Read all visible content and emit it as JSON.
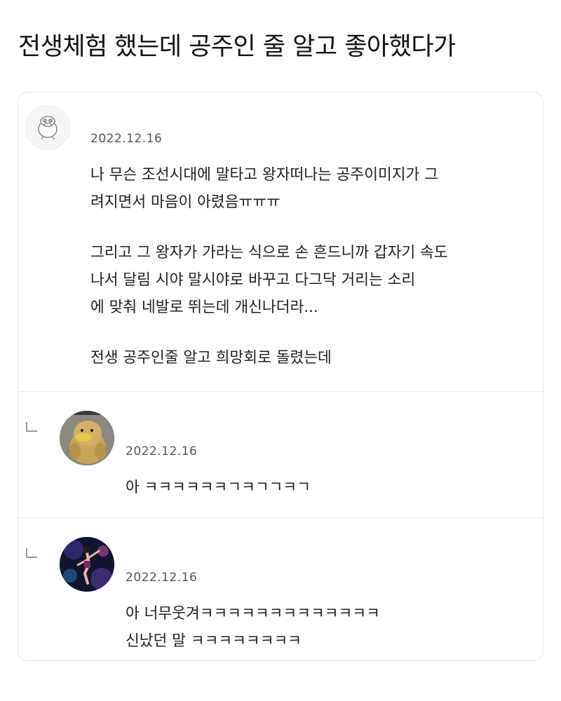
{
  "post_title": "전생체험 했는데 공주인 줄 알고 좋아했다가",
  "comment": {
    "avatar_icon": "character-face-icon",
    "date": "2022.12.16",
    "lines": [
      "나 무슨 조선시대에 말타고 왕자떠나는 공주이미지가 그",
      "려지면서 마음이 아렸음ㅠㅠㅠ",
      "그리고 그 왕자가 가라는 식으로 손 흔드니까 갑자기 속도",
      "나서 달림 시야 말시야로 바꾸고 다그닥 거리는 소리",
      "에 맞춰 네발로 뛰는데 개신나더라...",
      "전생 공주인줄 알고 희망회로 돌렸는데"
    ]
  },
  "replies": [
    {
      "avatar_icon": "duck-plush-icon",
      "date": "2022.12.16",
      "lines": [
        "아 ㅋㅋㅋㅋㅋㅋㄱㅋㄱㄱㅋㄱ"
      ]
    },
    {
      "avatar_icon": "dancer-photo-icon",
      "date": "2022.12.16",
      "lines": [
        "아 너무웃겨ㅋㅋㅋㅋㅋㅋㅋㅋㅋㅋㅋㅋㅋ",
        "신났던 말 ㅋㅋㅋㅋㅋㅋㅋㅋ"
      ]
    }
  ],
  "colors": {
    "card_border": "#e6e6e6",
    "divider": "#e8e8e8",
    "date_text": "#555555"
  }
}
